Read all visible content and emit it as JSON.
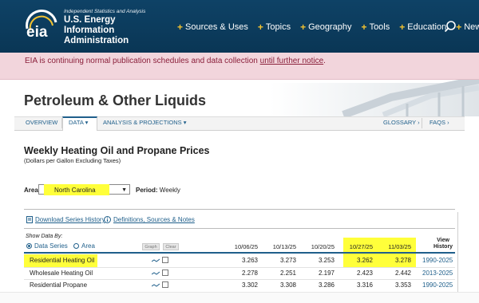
{
  "header": {
    "tagline": "Independent Statistics and Analysis",
    "org_line1": "U.S. Energy Information",
    "org_line2": "Administration",
    "logo_text": "eia",
    "nav": [
      {
        "label": "Sources & Uses"
      },
      {
        "label": "Topics"
      },
      {
        "label": "Geography"
      },
      {
        "label": "Tools"
      },
      {
        "label": "Education"
      },
      {
        "label": "News"
      }
    ]
  },
  "notice": {
    "text": "EIA is continuing normal publication schedules and data collection ",
    "link": "until further notice",
    "end": "."
  },
  "page": {
    "title": "Petroleum & Other Liquids",
    "tabs": {
      "overview": "OVERVIEW",
      "data": "DATA",
      "analysis": "ANALYSIS & PROJECTIONS",
      "glossary": "GLOSSARY",
      "faqs": "FAQS"
    }
  },
  "content": {
    "title": "Weekly Heating Oil and Propane Prices",
    "subtitle": "(Dollars per Gallon Excluding Taxes)",
    "area_label": "Area:",
    "area_value": "North Carolina",
    "period_label": "Period:",
    "period_value": "Weekly",
    "download_link": "Download Series History",
    "definitions_link": "Definitions, Sources & Notes",
    "show_by": "Show Data By:",
    "radio_series": "Data Series",
    "radio_area": "Area",
    "graph_btn": "Graph",
    "clear_btn": "Clear",
    "view_history_1": "View",
    "view_history_2": "History",
    "columns": [
      "10/06/25",
      "10/13/25",
      "10/20/25",
      "10/27/25",
      "11/03/25"
    ],
    "rows": [
      {
        "label": "Residential Heating Oil",
        "values": [
          "3.263",
          "3.273",
          "3.253",
          "3.262",
          "3.278"
        ],
        "history": "1990-2025"
      },
      {
        "label": "Wholesale Heating Oil",
        "values": [
          "2.278",
          "2.251",
          "2.197",
          "2.423",
          "2.442"
        ],
        "history": "2013-2025"
      },
      {
        "label": "Residential Propane",
        "values": [
          "3.302",
          "3.308",
          "3.286",
          "3.316",
          "3.353"
        ],
        "history": "1990-2025"
      }
    ]
  },
  "colors": {
    "header_bg": "#0b3c5d",
    "accent_gold": "#f2c230",
    "notice_bg": "#f2d5dc",
    "notice_text": "#8a1f3a",
    "link_blue": "#1f5f8b",
    "highlight": "#ffff3a"
  }
}
